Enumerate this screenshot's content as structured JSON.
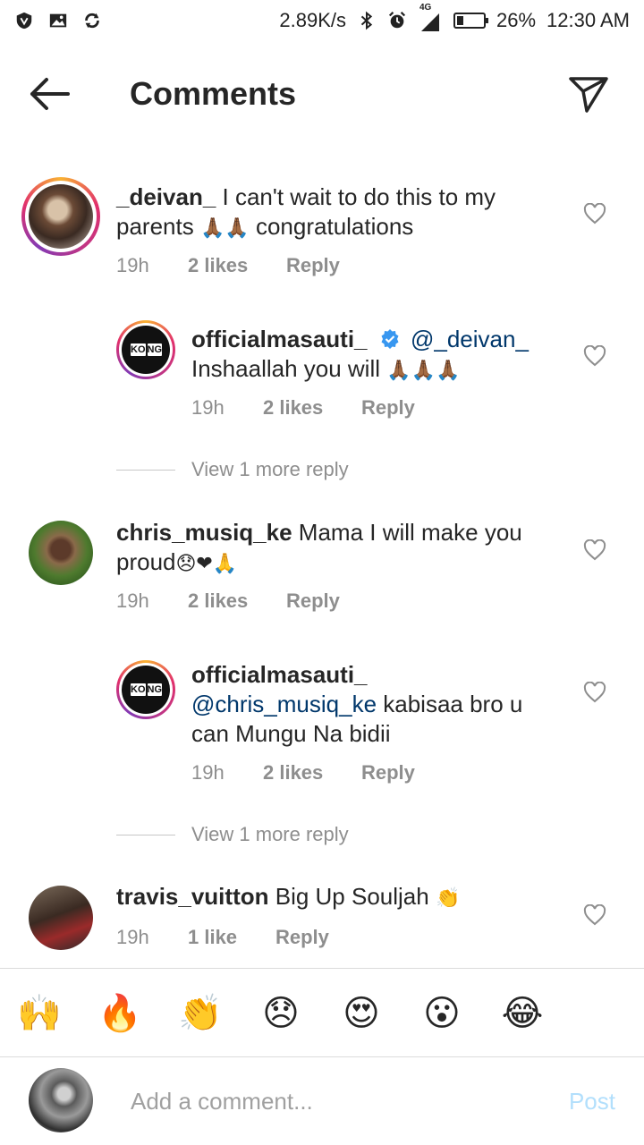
{
  "status_bar": {
    "speed": "2.89K/s",
    "network": "4G",
    "battery_percent": "26%",
    "battery_level": 0.26,
    "time": "12:30 AM",
    "icons": [
      "vpn-shield-icon",
      "image-icon",
      "sync-icon",
      "bluetooth-icon",
      "alarm-icon",
      "signal-icon",
      "battery-icon"
    ]
  },
  "header": {
    "title": "Comments",
    "back_icon": "arrow-left-icon",
    "share_icon": "send-icon"
  },
  "comments": [
    {
      "username": "_deivan_",
      "text_line1": " I can't wait to do this to my",
      "text_line2": "parents ",
      "emoji": "🙏🏾🙏🏾",
      "text_tail": " congratulations",
      "time": "19h",
      "likes": "2 likes",
      "reply": "Reply"
    },
    {
      "username": "officialmasauti_",
      "mention": "@_deivan_",
      "text": "Inshaallah you will ",
      "emoji": "🙏🏾🙏🏾🙏🏾",
      "time": "19h",
      "likes": "2 likes",
      "reply": "Reply",
      "view_more": "View 1 more reply"
    },
    {
      "username": "chris_musiq_ke",
      "text_line1": " Mama I will make you",
      "text_line2": "proud",
      "emoji": "😞❤🙏",
      "time": "19h",
      "likes": "2 likes",
      "reply": "Reply"
    },
    {
      "username": "officialmasauti_",
      "mention": "@chris_musiq_ke",
      "text_line1": " kabisaa bro u",
      "text_line2": "can Mungu Na bidii",
      "time": "19h",
      "likes": "2 likes",
      "reply": "Reply",
      "view_more": "View 1 more reply"
    },
    {
      "username": "travis_vuitton",
      "text": " Big Up Souljah ",
      "emoji": "👏",
      "time": "19h",
      "likes": "1 like",
      "reply": "Reply"
    }
  ],
  "avatar_logo": [
    "KO",
    "NG"
  ],
  "emoji_bar": [
    "🙌",
    "🔥",
    "👏",
    "😞",
    "😍",
    "😮",
    "😂"
  ],
  "composer": {
    "placeholder": "Add a comment...",
    "post_label": "Post"
  },
  "colors": {
    "link": "#00376b",
    "meta": "#8e8e8e",
    "post_disabled": "#b2dffc",
    "verified": "#3897f0"
  }
}
